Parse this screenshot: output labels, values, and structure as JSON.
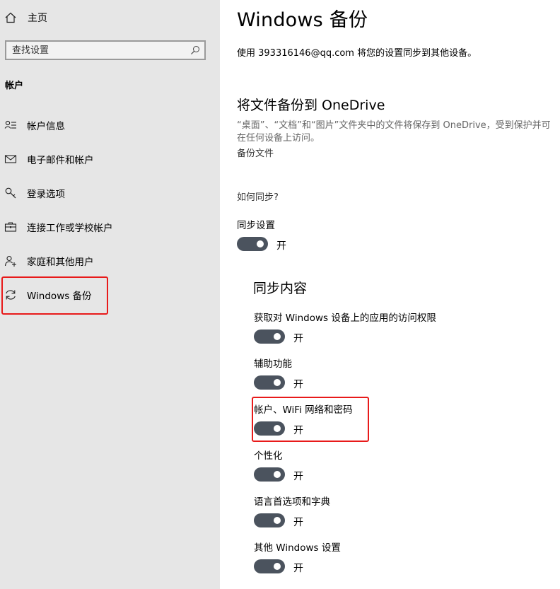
{
  "sidebar": {
    "home_label": "主页",
    "search_placeholder": "查找设置",
    "section_label": "帐户",
    "items": [
      {
        "label": "帐户信息",
        "icon": "account-info-icon"
      },
      {
        "label": "电子邮件和帐户",
        "icon": "mail-icon"
      },
      {
        "label": "登录选项",
        "icon": "key-icon"
      },
      {
        "label": "连接工作或学校帐户",
        "icon": "briefcase-icon"
      },
      {
        "label": "家庭和其他用户",
        "icon": "add-user-icon"
      },
      {
        "label": "Windows 备份",
        "icon": "sync-icon"
      }
    ]
  },
  "main": {
    "title": "Windows 备份",
    "description": "使用 393316146@qq.com 将您的设置同步到其他设备。",
    "onedrive": {
      "heading": "将文件备份到 OneDrive",
      "text": "“桌面”、“文档”和“图片”文件夹中的文件将保存到 OneDrive，受到保护并可在任何设备上访问。",
      "link": "备份文件"
    },
    "how_sync_link": "如何同步?",
    "sync_settings": {
      "label": "同步设置",
      "state": "开"
    },
    "sync_content": {
      "heading": "同步内容",
      "items": [
        {
          "label": "获取对 Windows 设备上的应用的访问权限",
          "state": "开"
        },
        {
          "label": "辅助功能",
          "state": "开"
        },
        {
          "label": "帐户、WiFi 网络和密码",
          "state": "开"
        },
        {
          "label": "个性化",
          "state": "开"
        },
        {
          "label": "语言首选项和字典",
          "state": "开"
        },
        {
          "label": "其他 Windows 设置",
          "state": "开"
        }
      ]
    }
  },
  "colors": {
    "sidebar_bg": "#e6e6e6",
    "toggle_on": "#4b535e",
    "highlight_box": "#e81a1a"
  }
}
